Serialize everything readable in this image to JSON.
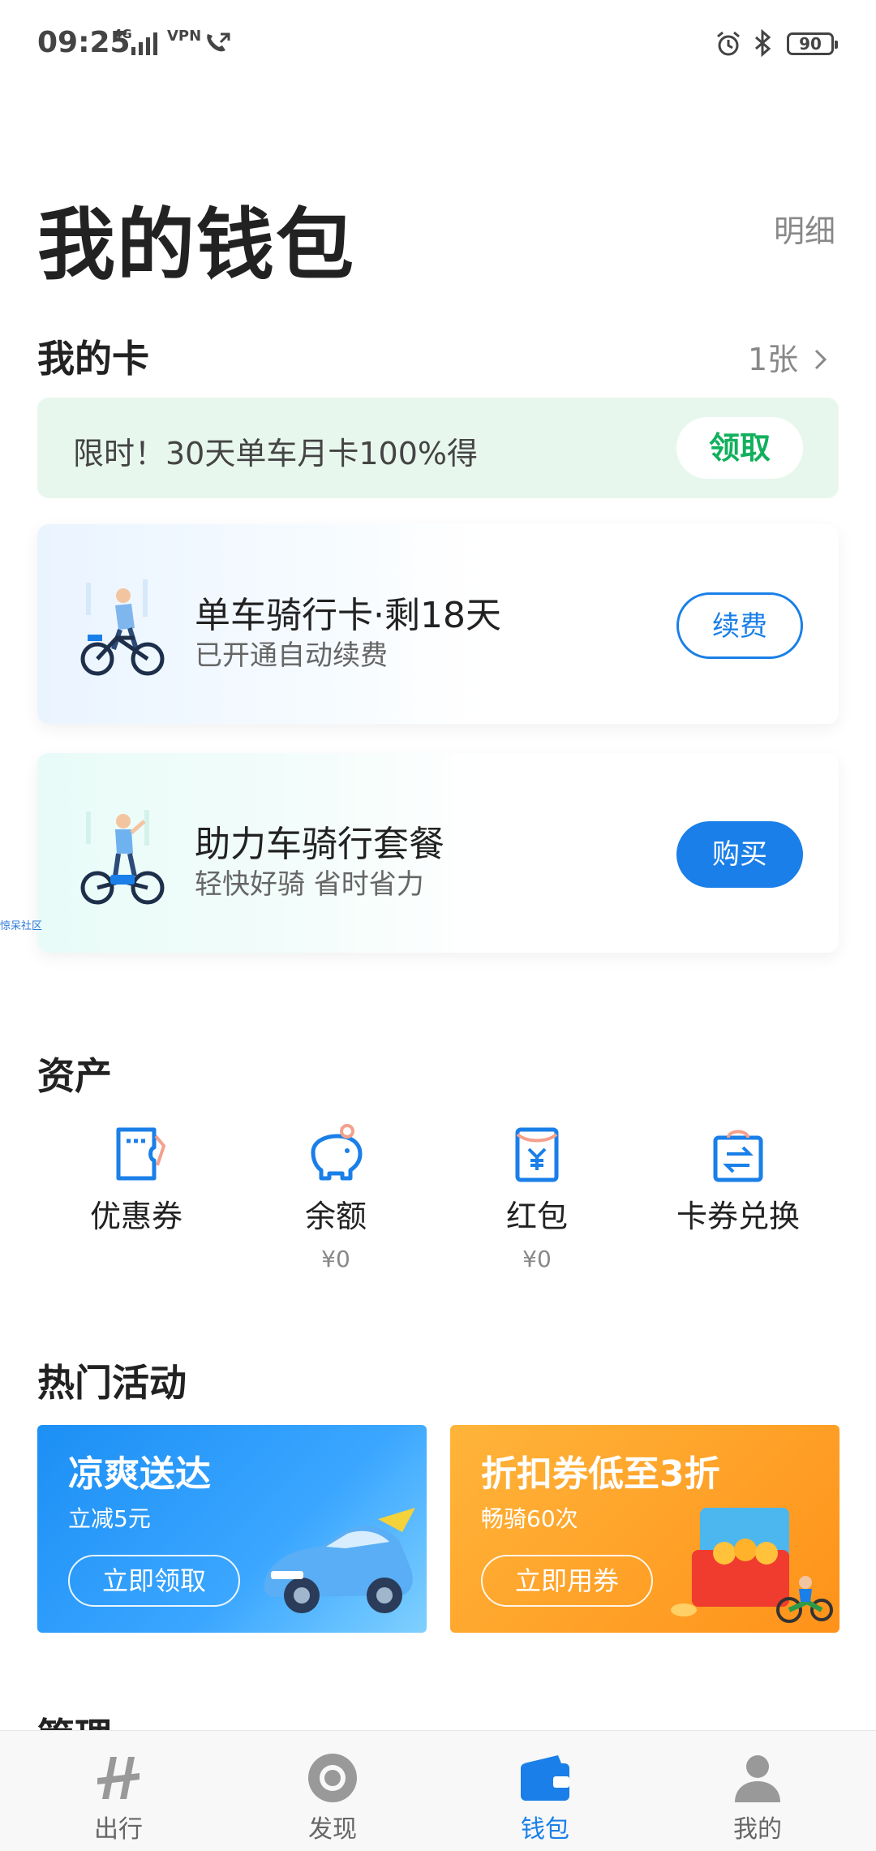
{
  "status_bar": {
    "time": "09:25",
    "network": "4G",
    "vpn": "VPN",
    "battery": "90"
  },
  "header": {
    "title": "我的钱包",
    "detail_link": "明细"
  },
  "my_cards": {
    "title": "我的卡",
    "count": "1张",
    "promo": {
      "text": "限时！30天单车月卡100%得",
      "button": "领取",
      "button_color": "#11b05d",
      "background": "#e8f7ee"
    },
    "cards": [
      {
        "title": "单车骑行卡·剩18天",
        "subtitle": "已开通自动续费",
        "button": "续费"
      },
      {
        "title": "助力车骑行套餐",
        "subtitle": "轻快好骑 省时省力",
        "button": "购买"
      }
    ]
  },
  "watermark": "惊呆社区",
  "assets": {
    "title": "资产",
    "items": [
      {
        "label": "优惠券",
        "amount": "",
        "icon": "coupon-icon"
      },
      {
        "label": "余额",
        "amount": "¥0",
        "icon": "piggy-bank-icon"
      },
      {
        "label": "红包",
        "amount": "¥0",
        "icon": "red-envelope-icon"
      },
      {
        "label": "卡券兑换",
        "amount": "",
        "icon": "exchange-icon"
      }
    ]
  },
  "activities": {
    "title": "热门活动",
    "banners": [
      {
        "title": "凉爽送达",
        "subtitle": "立减5元",
        "button": "立即领取",
        "color": "#1c8ff5"
      },
      {
        "title": "折扣券低至3折",
        "subtitle": "畅骑60次",
        "button": "立即用券",
        "color": "#ffa32a"
      }
    ]
  },
  "manage": {
    "title": "管理"
  },
  "bottom_nav": {
    "items": [
      {
        "label": "出行",
        "icon": "travel-icon"
      },
      {
        "label": "发现",
        "icon": "discover-icon"
      },
      {
        "label": "钱包",
        "icon": "wallet-icon",
        "active": true
      },
      {
        "label": "我的",
        "icon": "profile-icon"
      }
    ]
  },
  "colors": {
    "accent": "#1a7fe8",
    "green": "#11b05d"
  }
}
